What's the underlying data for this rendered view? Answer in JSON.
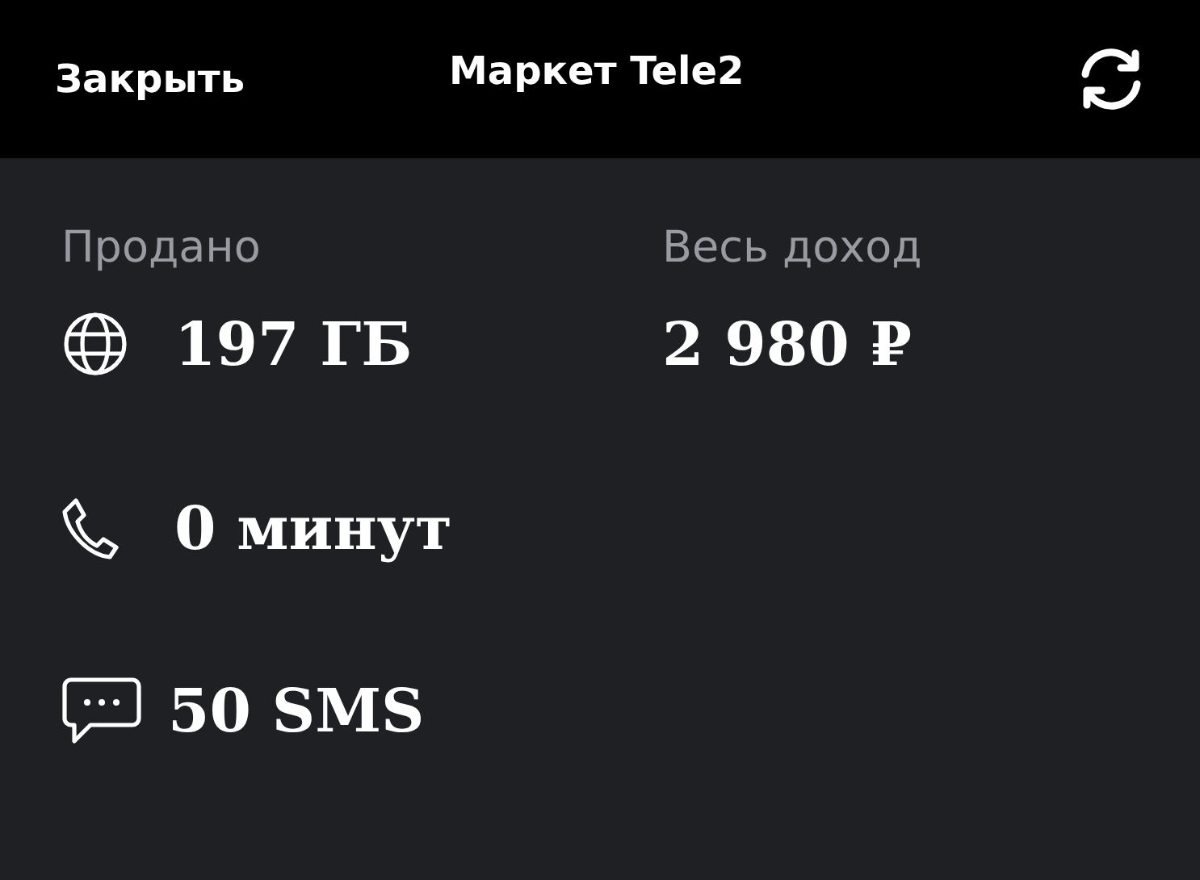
{
  "header": {
    "close": "Закрыть",
    "title": "Маркет Tele2"
  },
  "sold": {
    "label": "Продано",
    "items": [
      {
        "kind": "internet",
        "value": "197 ГБ"
      },
      {
        "kind": "calls",
        "value": "0 минут"
      },
      {
        "kind": "sms",
        "value": "50 SMS"
      }
    ]
  },
  "income": {
    "label": "Весь доход",
    "value": "2 980 ₽"
  }
}
